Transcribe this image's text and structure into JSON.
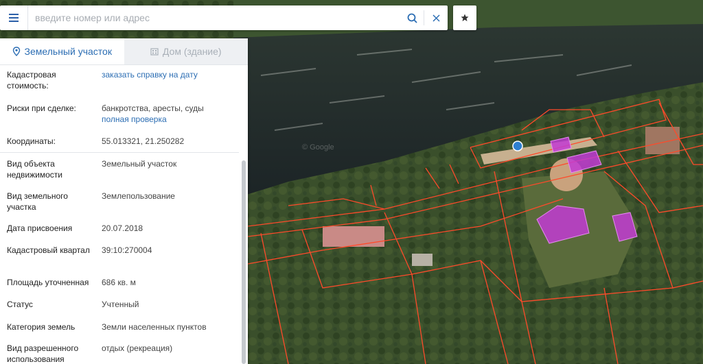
{
  "search": {
    "placeholder": "введите номер или адрес"
  },
  "icons": {
    "menu": "menu-icon",
    "search": "search-icon",
    "clear": "close-icon",
    "favorite": "star-icon",
    "parcel": "location-pin-icon",
    "building": "building-icon"
  },
  "tabs": [
    {
      "label": "Земельный участок",
      "active": true
    },
    {
      "label": "Дом (здание)",
      "active": false
    }
  ],
  "info": {
    "cadastral_cost": {
      "label": "Кадастровая стоимость:",
      "link": "заказать справку на дату"
    },
    "risks": {
      "label": "Риски при сделке:",
      "value": "банкротства, аресты, суды",
      "link": "полная проверка"
    },
    "coords": {
      "label": "Координаты:",
      "value": "55.013321, 21.250282"
    },
    "object_type": {
      "label": "Вид объекта недвижимости",
      "value": "Земельный участок"
    },
    "land_type": {
      "label": "Вид земельного участка",
      "value": "Землепользование"
    },
    "assign_date": {
      "label": "Дата присвоения",
      "value": "20.07.2018"
    },
    "quarter": {
      "label": "Кадастровый квартал",
      "value": "39:10:270004"
    },
    "area": {
      "label": "Площадь уточненная",
      "value": "686 кв. м"
    },
    "status": {
      "label": "Статус",
      "value": "Учтенный"
    },
    "category": {
      "label": "Категория земель",
      "value": "Земли населенных пунктов"
    },
    "permitted_use": {
      "label": "Вид разрешенного использования",
      "value": "отдых (рекреация)"
    }
  },
  "map": {
    "watermark": "© Google",
    "colors": {
      "parcel_border": "#ff4a2a",
      "building_fill": "#c23bd4",
      "marker": "#2e7fd0",
      "river": "#1f2a2c",
      "vegetation": "#39502c"
    }
  }
}
